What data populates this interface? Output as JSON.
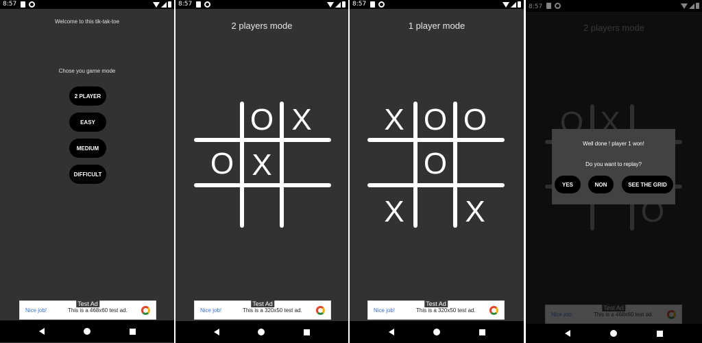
{
  "status": {
    "time": "8:57"
  },
  "screen1": {
    "welcome": "Welcome to this tik-tak-toe",
    "choose": "Chose you game mode",
    "buttons": [
      "2 PLAYER",
      "EASY",
      "MEDIUM",
      "DIFFICULT"
    ]
  },
  "screen2": {
    "title": "2 players mode",
    "board": [
      "",
      "O",
      "X",
      "O",
      "X",
      "",
      "",
      "",
      ""
    ]
  },
  "screen3": {
    "title": "1 player mode",
    "board": [
      "X",
      "O",
      "O",
      "",
      "O",
      "",
      "X",
      "",
      "X"
    ]
  },
  "screen4": {
    "title": "2 players mode",
    "board_visible": [
      "O",
      "X",
      "",
      "",
      "",
      "",
      "",
      "",
      "O"
    ],
    "dialog": {
      "message": "Well done ! player 1 won!",
      "question": "Do you want to replay?",
      "yes": "YES",
      "non": "NON",
      "see_grid": "SEE THE GRID"
    }
  },
  "ads": {
    "badge": "Test Ad",
    "nice": "Nice job!",
    "text_468": "This is a 468x60 test ad.",
    "text_320": "This is a 320x50 test ad."
  },
  "icons": {
    "status": [
      "sd-card-icon",
      "cast-icon",
      "wifi-icon",
      "signal-icon",
      "battery-icon"
    ],
    "nav": [
      "back-icon",
      "home-icon",
      "recents-icon"
    ]
  }
}
